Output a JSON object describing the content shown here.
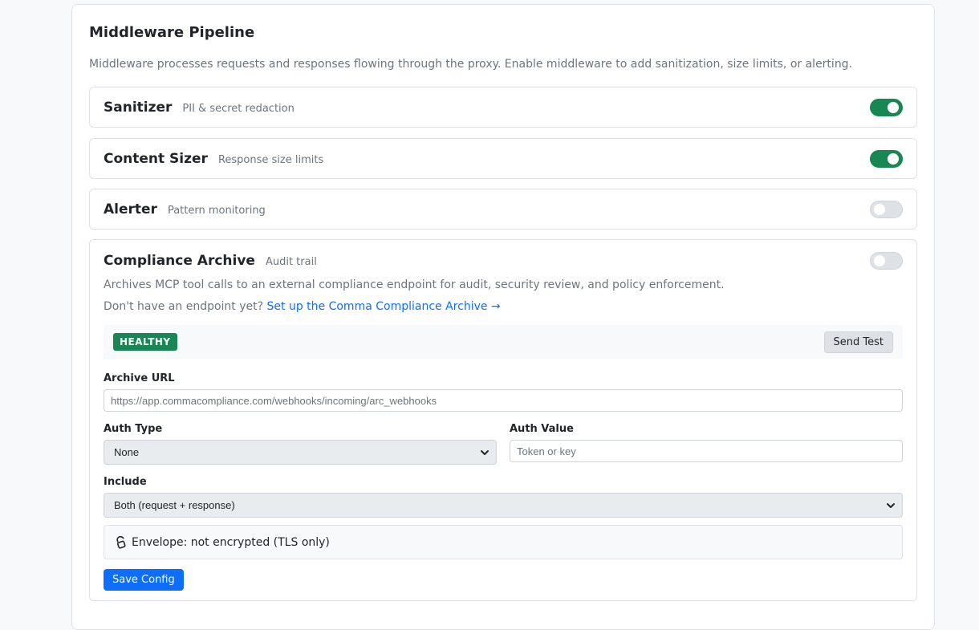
{
  "panel": {
    "title": "Middleware Pipeline",
    "description": "Middleware processes requests and responses flowing through the proxy. Enable middleware to add sanitization, size limits, or alerting."
  },
  "middleware": [
    {
      "name": "Sanitizer",
      "subtitle": "PII & secret redaction",
      "enabled": true
    },
    {
      "name": "Content Sizer",
      "subtitle": "Response size limits",
      "enabled": true
    },
    {
      "name": "Alerter",
      "subtitle": "Pattern monitoring",
      "enabled": false
    }
  ],
  "archive": {
    "name": "Compliance Archive",
    "subtitle": "Audit trail",
    "enabled": false,
    "description": "Archives MCP tool calls to an external compliance endpoint for audit, security review, and policy enforcement.",
    "endpoint_prompt": "Don't have an endpoint yet?",
    "endpoint_link": "Set up the Comma Compliance Archive →",
    "status_badge": "HEALTHY",
    "send_test_label": "Send Test",
    "url_label": "Archive URL",
    "url_value": "https://app.commacompliance.com/webhooks/incoming/arc_webhooks",
    "auth_type_label": "Auth Type",
    "auth_type_value": "None",
    "auth_value_label": "Auth Value",
    "auth_value_placeholder": "Token or key",
    "include_label": "Include",
    "include_value": "Both (request + response)",
    "envelope_text": "Envelope: not encrypted (TLS only)",
    "save_label": "Save Config"
  },
  "colors": {
    "toggle_on": "#198754",
    "toggle_off": "#dee2e6",
    "link": "#0d6efd",
    "badge_healthy": "#198754",
    "primary_button": "#0d6efd"
  },
  "icons": {
    "envelope_status": "unlocked-icon",
    "select_caret": "chevron-down-icon"
  }
}
